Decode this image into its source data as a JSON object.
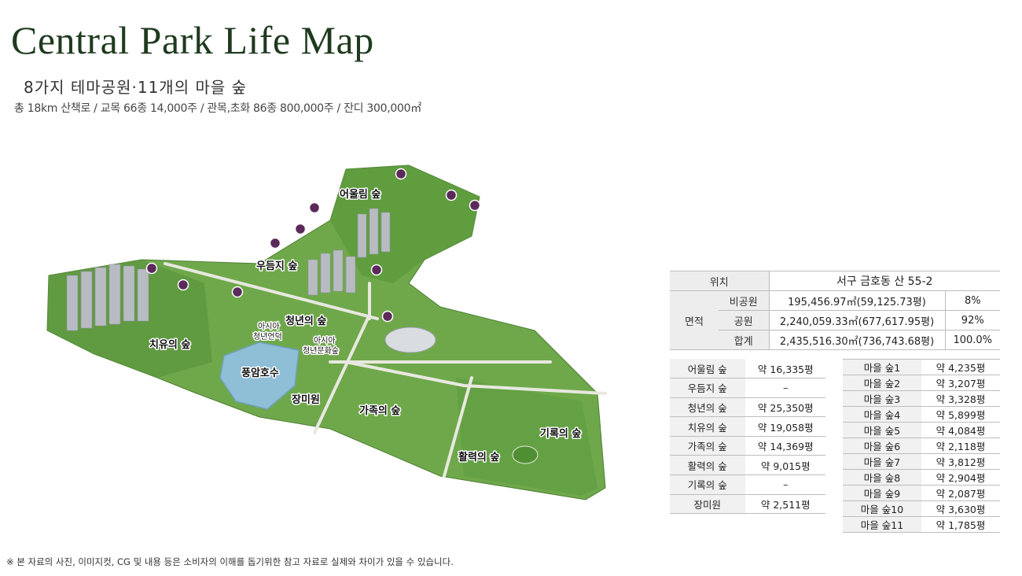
{
  "header": {
    "title": "Central Park Life Map",
    "subtitle": "8가지 테마공원·11개의 마을 숲",
    "stats": "총 18km 산책로 / 교목 66종 14,000주 / 관목,초화 86종 800,000주 / 잔디 300,000㎡"
  },
  "map": {
    "labels": {
      "eoullim": "어울림 숲",
      "udeumji": "우듬지 숲",
      "cheongnyeon": "청년의 숲",
      "asia_hill_1": "아시아",
      "asia_hill_2": "청년언덕",
      "asia_culture_1": "아시아",
      "asia_culture_2": "청년문화숲",
      "chiyu": "치유의 숲",
      "pungam": "풍암호수",
      "jangmi": "장미원",
      "gajok": "가족의 숲",
      "hwalryeok": "활력의 숲",
      "girok": "기록의 숲"
    },
    "marker_color": "#5b2a5a"
  },
  "info_table": {
    "location_label": "위치",
    "location_value": "서구 금호동 산 55-2",
    "area_label": "면적",
    "rows": [
      {
        "label": "비공원",
        "value": "195,456.97㎡(59,125.73평)",
        "pct": "8%"
      },
      {
        "label": "공원",
        "value": "2,240,059.33㎡(677,617.95평)",
        "pct": "92%"
      },
      {
        "label": "합계",
        "value": "2,435,516.30㎡(736,743.68평)",
        "pct": "100.0%"
      }
    ]
  },
  "forest_table": [
    {
      "name": "어울림 숲",
      "area": "약 16,335평"
    },
    {
      "name": "우듬지 숲",
      "area": "–"
    },
    {
      "name": "청년의 숲",
      "area": "약 25,350평"
    },
    {
      "name": "치유의 숲",
      "area": "약 19,058평"
    },
    {
      "name": "가족의 숲",
      "area": "약 14,369평"
    },
    {
      "name": "활력의 숲",
      "area": "약 9,015평"
    },
    {
      "name": "기록의 숲",
      "area": "–"
    },
    {
      "name": "장미원",
      "area": "약 2,511평"
    }
  ],
  "village_table": [
    {
      "name": "마을 숲1",
      "area": "약 4,235평"
    },
    {
      "name": "마을 숲2",
      "area": "약 3,207평"
    },
    {
      "name": "마을 숲3",
      "area": "약 3,328평"
    },
    {
      "name": "마을 숲4",
      "area": "약 5,899평"
    },
    {
      "name": "마을 숲5",
      "area": "약 4,084평"
    },
    {
      "name": "마을 숲6",
      "area": "약 2,118평"
    },
    {
      "name": "마을 숲7",
      "area": "약 3,812평"
    },
    {
      "name": "마을 숲8",
      "area": "약 2,904평"
    },
    {
      "name": "마을 숲9",
      "area": "약 2,087평"
    },
    {
      "name": "마을 숲10",
      "area": "약 3,630평"
    },
    {
      "name": "마을 숲11",
      "area": "약 1,785평"
    }
  ],
  "footnote": "※ 본 자료의 사진, 이미지컷, CG 및 내용 등은 소비자의 이해를 돕기위한 참고 자료로 실제와 차이가 있을 수 있습니다."
}
